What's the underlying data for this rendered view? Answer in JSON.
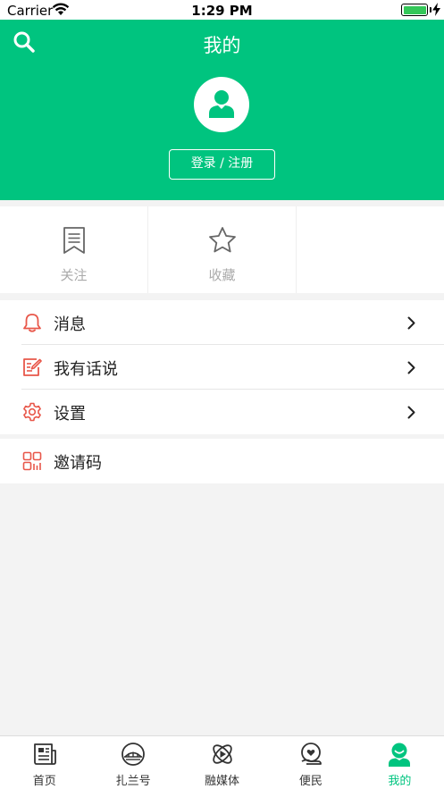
{
  "status_bar": {
    "carrier": "Carrier",
    "time": "1:29 PM",
    "battery_level": 1.0
  },
  "header": {
    "title": "我的",
    "login_label": "登录 / 注册",
    "accent_color": "#00c47f"
  },
  "quick_items": [
    {
      "label": "关注",
      "icon": "bookmark-icon"
    },
    {
      "label": "收藏",
      "icon": "star-icon"
    },
    {
      "label": "",
      "icon": ""
    }
  ],
  "menu": {
    "group1": [
      {
        "label": "消息",
        "icon": "bell-icon"
      },
      {
        "label": "我有话说",
        "icon": "edit-note-icon"
      },
      {
        "label": "设置",
        "icon": "gear-icon"
      }
    ],
    "group2": [
      {
        "label": "邀请码",
        "icon": "qr-code-icon"
      }
    ],
    "icon_color": "#e8574a"
  },
  "tab_bar": {
    "tabs": [
      {
        "label": "首页",
        "icon": "newspaper-icon",
        "active": false
      },
      {
        "label": "扎兰号",
        "icon": "bridge-icon",
        "active": false
      },
      {
        "label": "融媒体",
        "icon": "media-play-icon",
        "active": false
      },
      {
        "label": "便民",
        "icon": "heart-hand-icon",
        "active": false
      },
      {
        "label": "我的",
        "icon": "profile-icon",
        "active": true
      }
    ]
  }
}
